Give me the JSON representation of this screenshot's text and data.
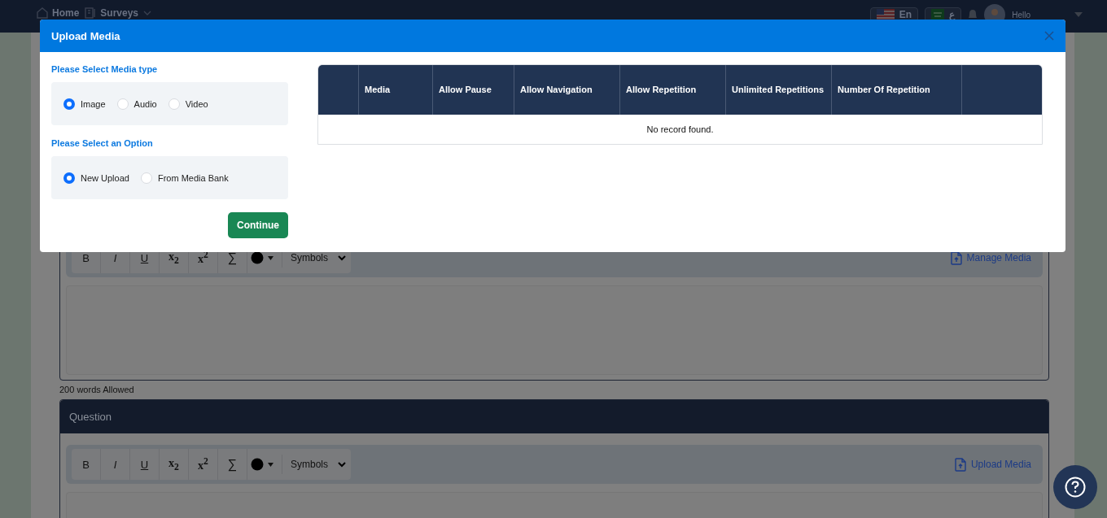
{
  "nav": {
    "items": [
      {
        "label": "Home",
        "kind": "home"
      },
      {
        "label": "Surveys",
        "kind": "surveys"
      }
    ],
    "languages": [
      {
        "label": "En",
        "kind": "us"
      },
      {
        "label": "ع",
        "kind": "sa"
      }
    ],
    "user": {
      "greeting": "Hello"
    }
  },
  "modal": {
    "title": "Upload Media",
    "groups": [
      {
        "label": "Please Select Media type",
        "options": [
          {
            "label": "Image",
            "selected": true
          },
          {
            "label": "Audio",
            "selected": false
          },
          {
            "label": "Video",
            "selected": false
          }
        ]
      },
      {
        "label": "Please Select an Option",
        "options": [
          {
            "label": "New Upload",
            "selected": true
          },
          {
            "label": "From Media Bank",
            "selected": false
          }
        ]
      }
    ],
    "continue": "Continue",
    "table": {
      "columns": [
        "Media",
        "Allow Pause",
        "Allow Navigation",
        "Allow Repetition",
        "Unlimited Repetitions",
        "Number Of Repetition"
      ],
      "empty": "No record found."
    }
  },
  "editors": [
    {
      "tools": [
        "B",
        "I",
        "U",
        "x$_{2}$",
        "x$^{2}$",
        "∑"
      ],
      "symbols": "Symbols",
      "media_link": "Manage Media",
      "hint": "200 words Allowed"
    },
    {
      "title": "Question",
      "tools": [
        "B",
        "I",
        "U",
        "x$_{2}$",
        "x$^{2}$",
        "∑"
      ],
      "symbols": "Symbols",
      "media_link": "Upload Media"
    }
  ]
}
